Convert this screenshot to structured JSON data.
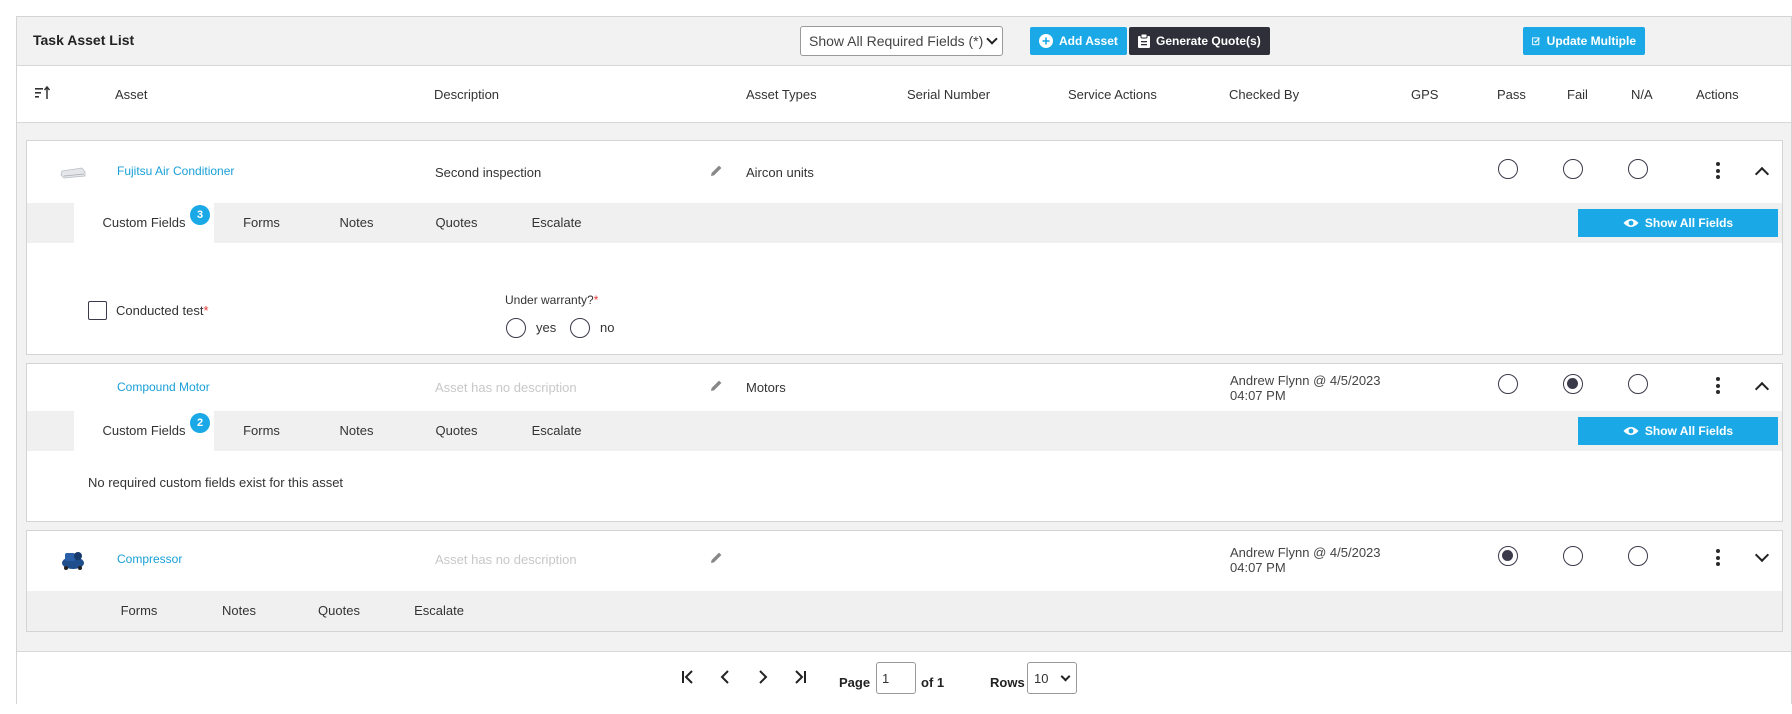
{
  "toolbar": {
    "title": "Task Asset List",
    "filter_select": "Show All Required Fields (*)",
    "add_asset_label": "Add Asset",
    "generate_quote_label": "Generate Quote(s)",
    "update_multiple_label": "Update Multiple"
  },
  "columns": {
    "asset": "Asset",
    "description": "Description",
    "asset_types": "Asset Types",
    "serial_number": "Serial Number",
    "service_actions": "Service Actions",
    "checked_by": "Checked By",
    "gps": "GPS",
    "pass": "Pass",
    "fail": "Fail",
    "na": "N/A",
    "actions": "Actions"
  },
  "assets": [
    {
      "name": "Fujitsu Air Conditioner",
      "description": "Second inspection",
      "asset_type": "Aircon units",
      "checked_by_line1": "",
      "checked_by_line2": "",
      "status": "none",
      "tabs": [
        {
          "label": "Custom Fields",
          "count": "3"
        },
        {
          "label": "Forms"
        },
        {
          "label": "Notes"
        },
        {
          "label": "Quotes"
        },
        {
          "label": "Escalate"
        }
      ],
      "show_all_label": "Show All Fields",
      "fields": {
        "conducted_test_label": "Conducted test",
        "required_marker": "*",
        "warranty_label": "Under warranty?",
        "warranty_options": [
          "yes",
          "no"
        ]
      }
    },
    {
      "name": "Compound Motor",
      "description": "Asset has no description",
      "asset_type": "Motors",
      "checked_by_line1": "Andrew Flynn @ 4/5/2023",
      "checked_by_line2": "04:07 PM",
      "status": "fail",
      "tabs": [
        {
          "label": "Custom Fields",
          "count": "2"
        },
        {
          "label": "Forms"
        },
        {
          "label": "Notes"
        },
        {
          "label": "Quotes"
        },
        {
          "label": "Escalate"
        }
      ],
      "show_all_label": "Show All Fields",
      "empty_message": "No required custom fields exist for this asset"
    },
    {
      "name": "Compressor",
      "description": "Asset has no description",
      "asset_type": "",
      "checked_by_line1": "Andrew Flynn @ 4/5/2023",
      "checked_by_line2": "04:07 PM",
      "status": "pass",
      "tabs": [
        {
          "label": "Forms"
        },
        {
          "label": "Notes"
        },
        {
          "label": "Quotes"
        },
        {
          "label": "Escalate"
        }
      ]
    }
  ],
  "pagination": {
    "page_label": "Page",
    "page_value": "1",
    "of_label": "of 1",
    "rows_label": "Rows",
    "rows_value": "10"
  },
  "colors": {
    "accent": "#1aa9e6",
    "dark_button": "#2f2f3a",
    "link": "#1aa0d8",
    "required": "#e53935"
  }
}
